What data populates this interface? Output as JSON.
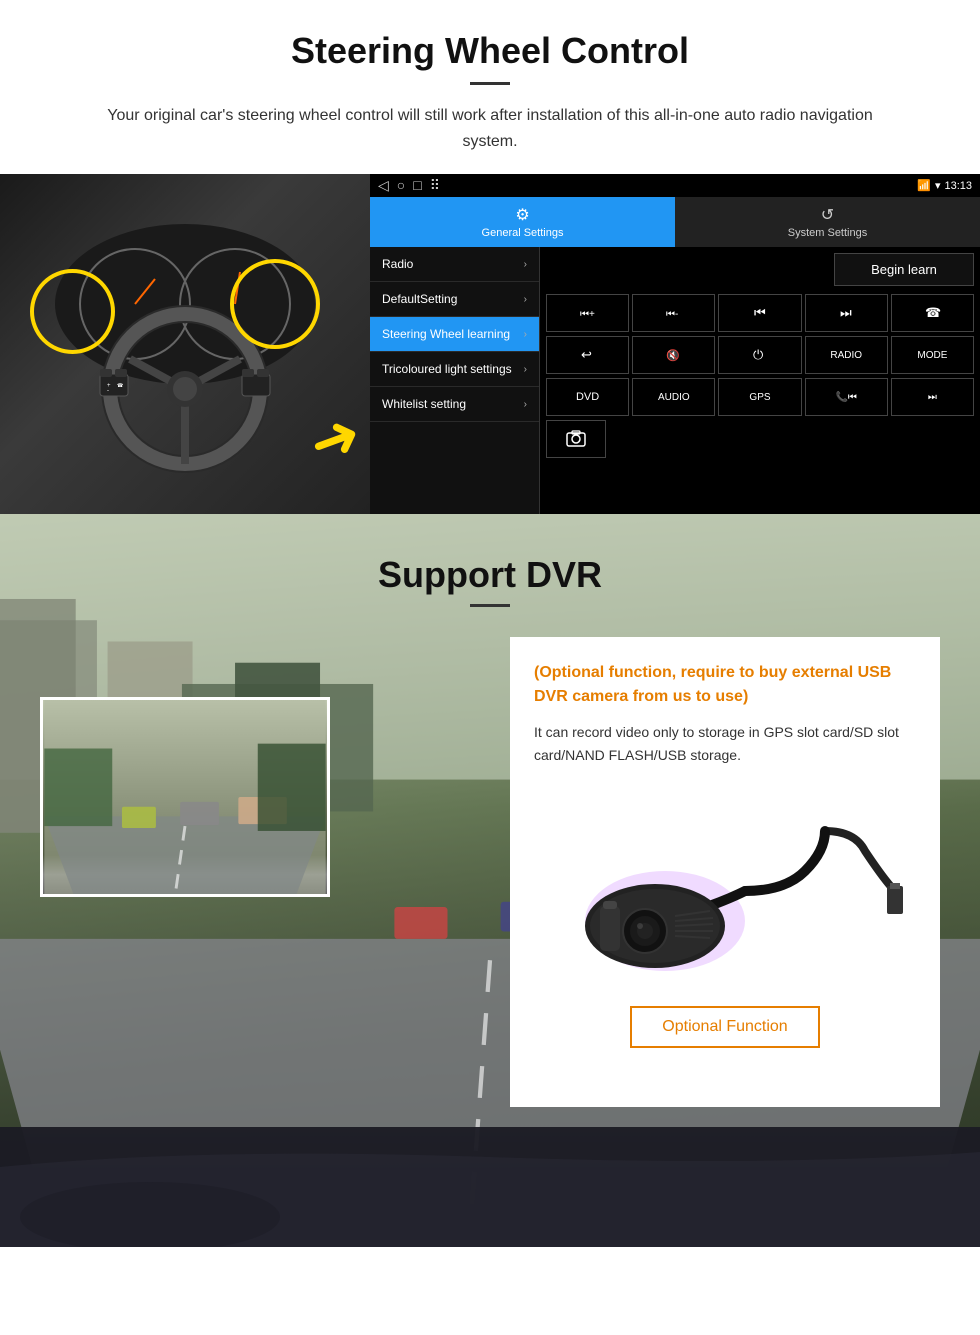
{
  "page": {
    "section1": {
      "title": "Steering Wheel Control",
      "subtitle": "Your original car's steering wheel control will still work after installation of this all-in-one auto radio navigation system.",
      "android_ui": {
        "status_bar": {
          "nav_back": "◁",
          "nav_home": "○",
          "nav_square": "□",
          "nav_dots": "⠿",
          "time": "13:13",
          "signal": "▼",
          "wifi": "▾"
        },
        "tabs": [
          {
            "id": "general",
            "icon": "⚙",
            "label": "General Settings",
            "active": true
          },
          {
            "id": "system",
            "icon": "↺",
            "label": "System Settings",
            "active": false
          }
        ],
        "menu_items": [
          {
            "id": "radio",
            "label": "Radio",
            "active": false
          },
          {
            "id": "defaultsetting",
            "label": "DefaultSetting",
            "active": false
          },
          {
            "id": "steering",
            "label": "Steering Wheel learning",
            "active": true
          },
          {
            "id": "tricoloured",
            "label": "Tricoloured light settings",
            "active": false
          },
          {
            "id": "whitelist",
            "label": "Whitelist setting",
            "active": false
          }
        ],
        "begin_learn_btn": "Begin learn",
        "control_buttons_row1": [
          "⏮+",
          "⏮-",
          "⏮",
          "⏭",
          "☎"
        ],
        "control_buttons_row2": [
          "↩",
          "🔇",
          "⏻",
          "RADIO",
          "MODE"
        ],
        "control_buttons_row3": [
          "DVD",
          "AUDIO",
          "GPS",
          "📞⏮",
          "⏭"
        ]
      }
    },
    "section2": {
      "title": "Support DVR",
      "optional_text": "(Optional function, require to buy external USB DVR camera from us to use)",
      "desc_text": "It can record video only to storage in GPS slot card/SD slot card/NAND FLASH/USB storage.",
      "optional_function_label": "Optional Function"
    }
  }
}
